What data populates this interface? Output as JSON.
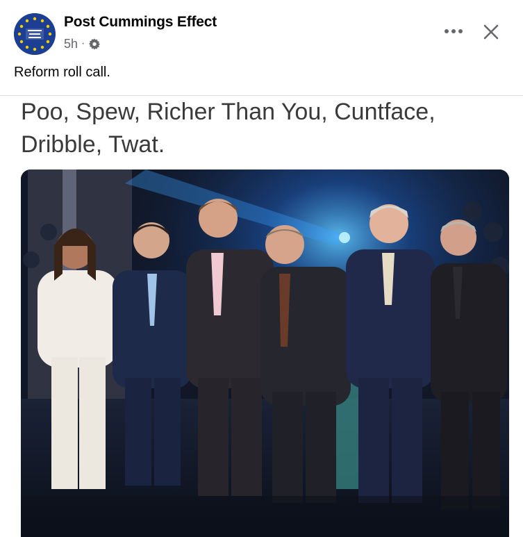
{
  "post": {
    "author": "Post Cummings Effect",
    "time": "5h",
    "separator": "·",
    "privacy_icon": "gear-icon",
    "text": "Reform roll call.",
    "menu_icon": "more-options-icon",
    "close_icon": "close-icon"
  },
  "image": {
    "caption_line1": "Poo, Spew, Richer Than You, Cuntface,",
    "caption_line2": "Dribble, Twat.",
    "photo_description_icon": "group-photo"
  },
  "colors": {
    "avatar_blue": "#1c3f94",
    "avatar_star": "#f5d000",
    "meta_gray": "#65676b",
    "caption_gray": "#3a3a3a",
    "stage_light": "#2aa8ff"
  }
}
